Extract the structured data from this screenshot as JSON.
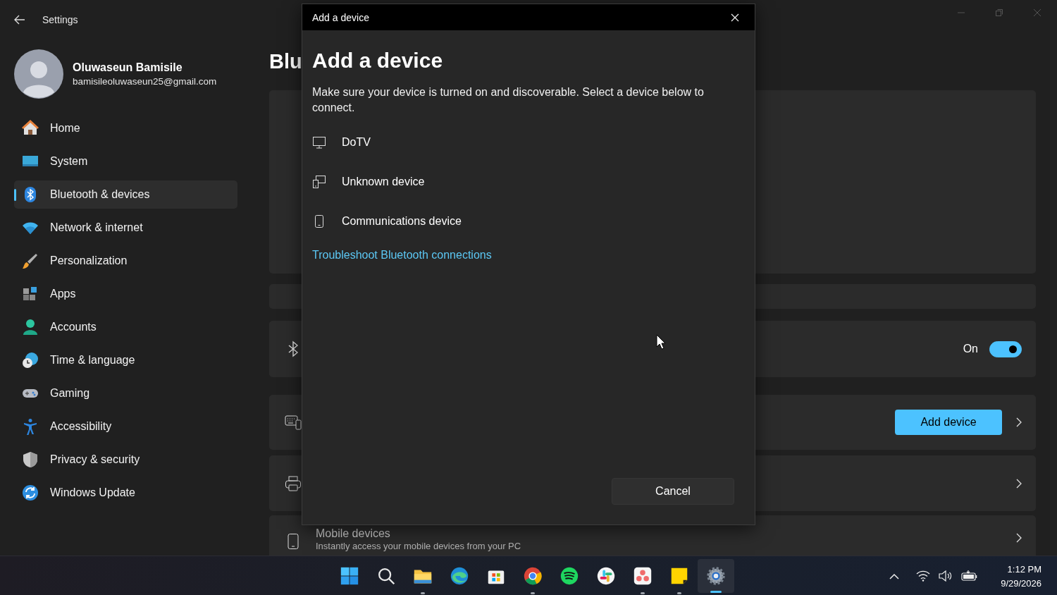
{
  "window": {
    "title": "Settings"
  },
  "user": {
    "name": "Oluwaseun Bamisile",
    "email": "bamisileoluwaseun25@gmail.com"
  },
  "sidebar": {
    "items": [
      {
        "label": "Home",
        "selected": false
      },
      {
        "label": "System",
        "selected": false
      },
      {
        "label": "Bluetooth & devices",
        "selected": true
      },
      {
        "label": "Network & internet",
        "selected": false
      },
      {
        "label": "Personalization",
        "selected": false
      },
      {
        "label": "Apps",
        "selected": false
      },
      {
        "label": "Accounts",
        "selected": false
      },
      {
        "label": "Time & language",
        "selected": false
      },
      {
        "label": "Gaming",
        "selected": false
      },
      {
        "label": "Accessibility",
        "selected": false
      },
      {
        "label": "Privacy & security",
        "selected": false
      },
      {
        "label": "Windows Update",
        "selected": false
      }
    ]
  },
  "page": {
    "title": "Blu",
    "cards": [
      {
        "kind": "blank"
      },
      {
        "kind": "strip"
      },
      {
        "kind": "toggle",
        "state_label": "On",
        "on": true
      },
      {
        "kind": "button",
        "button": "Add device"
      },
      {
        "kind": "link"
      },
      {
        "kind": "text",
        "title": "Mobile devices",
        "subtitle": "Instantly access your mobile devices from your PC"
      }
    ]
  },
  "dialog": {
    "caption": "Add a device",
    "title": "Add a device",
    "description": "Make sure your device is turned on and discoverable. Select a device below to connect.",
    "devices": [
      {
        "name": "DoTV"
      },
      {
        "name": "Unknown device"
      },
      {
        "name": "Communications device"
      }
    ],
    "link": "Troubleshoot Bluetooth connections",
    "cancel": "Cancel"
  },
  "taskbar": {
    "apps": [
      {
        "running": false,
        "active": false
      },
      {
        "running": false,
        "active": false
      },
      {
        "running": true,
        "active": false
      },
      {
        "running": false,
        "active": false
      },
      {
        "running": false,
        "active": false
      },
      {
        "running": true,
        "active": false
      },
      {
        "running": false,
        "active": false
      },
      {
        "running": false,
        "active": false
      },
      {
        "running": true,
        "active": false
      },
      {
        "running": true,
        "active": false
      },
      {
        "running": true,
        "active": true
      }
    ],
    "time": "1:12 PM",
    "date": "9/29/2026"
  }
}
